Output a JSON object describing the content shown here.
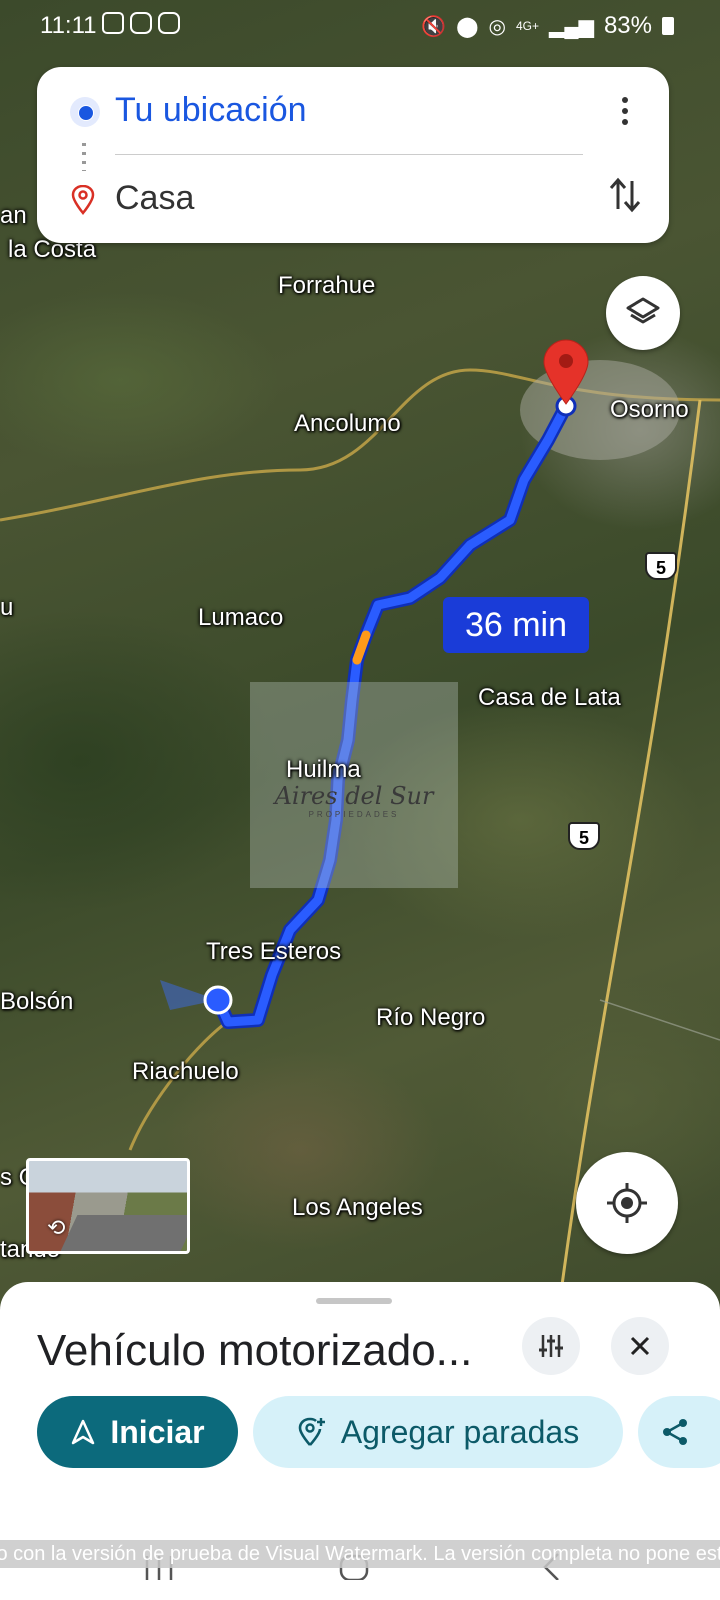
{
  "status_bar": {
    "time": "11:11",
    "battery": "83%",
    "network": "4G+"
  },
  "directions": {
    "origin": "Tu ubicación",
    "destination": "Casa"
  },
  "map": {
    "labels": {
      "la_costa": "la Costa",
      "an": "an",
      "forrahue": "Forrahue",
      "osorno": "Osorno",
      "ancolumo": "Ancolumo",
      "u": "u",
      "lumaco": "Lumaco",
      "casa_de_lata": "Casa de Lata",
      "huilma": "Huilma",
      "tres_esteros": "Tres Esteros",
      "bolson": "Bolsón",
      "rio_negro": "Río Negro",
      "riachuelo": "Riachuelo",
      "los_angeles": "Los Angeles",
      "s_c": "s C",
      "tando": "tando"
    },
    "route_duration": "36 min",
    "highway_shield": "5",
    "watermark": {
      "title": "Aires del Sur",
      "subtitle": "PROPIEDADES"
    }
  },
  "sheet": {
    "title": "Vehículo motorizado...",
    "start_label": "Iniciar",
    "add_stops_label": "Agregar paradas"
  },
  "trial_banner": "lo con la versión de prueba de Visual Watermark. La versión completa no pone esta"
}
